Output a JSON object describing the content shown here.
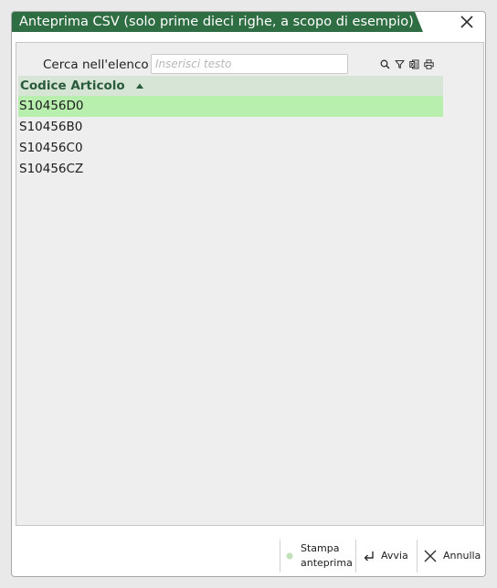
{
  "window": {
    "title": "Anteprima CSV (solo prime dieci righe, a scopo di esempio)",
    "accent_color": "#2f6d43",
    "close_icon": "close-x-icon"
  },
  "search": {
    "label": "Cerca nell'elenco",
    "placeholder": "Inserisci testo",
    "value": ""
  },
  "tools": [
    {
      "name": "search-icon"
    },
    {
      "name": "filter-icon"
    },
    {
      "name": "excel-export-icon"
    },
    {
      "name": "print-icon"
    }
  ],
  "grid": {
    "columns": [
      {
        "label": "Codice Articolo",
        "sort": "ascending"
      }
    ],
    "rows": [
      {
        "codice": "S10456D0",
        "selected": true
      },
      {
        "codice": "S10456B0",
        "selected": false
      },
      {
        "codice": "S10456C0",
        "selected": false
      },
      {
        "codice": "S10456CZ",
        "selected": false
      }
    ],
    "header_bg": "#d6e5d5",
    "selected_bg": "#b8eeae"
  },
  "footer": {
    "stampa_line1": "Stampa",
    "stampa_line2": "anteprima",
    "avvia": "Avvia",
    "annulla": "Annulla"
  }
}
